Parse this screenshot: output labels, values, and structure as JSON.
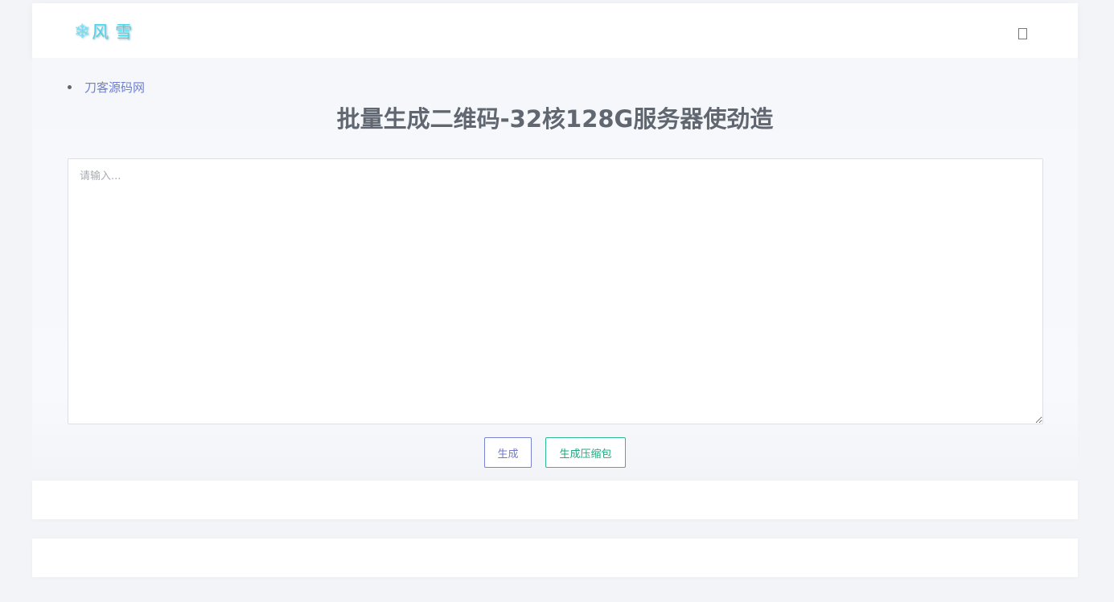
{
  "navbar": {
    "brand_icon": "snowflake-icon",
    "brand_glyph": "❄",
    "brand_text": "风雪",
    "menu_icon": "menu-toggle-icon"
  },
  "breadcrumb": {
    "items": [
      {
        "label": "刀客源码网"
      }
    ]
  },
  "main": {
    "title": "批量生成二维码-32核128G服务器使劲造",
    "input": {
      "placeholder": "请输入...",
      "value": ""
    },
    "buttons": {
      "generate_label": "生成",
      "zip_label": "生成压缩包"
    }
  },
  "colors": {
    "brand": "#4fd4e6",
    "link": "#6f7fcf",
    "generate_button": "#7a83d3",
    "zip_button": "#2fbb91",
    "title": "#606770"
  }
}
